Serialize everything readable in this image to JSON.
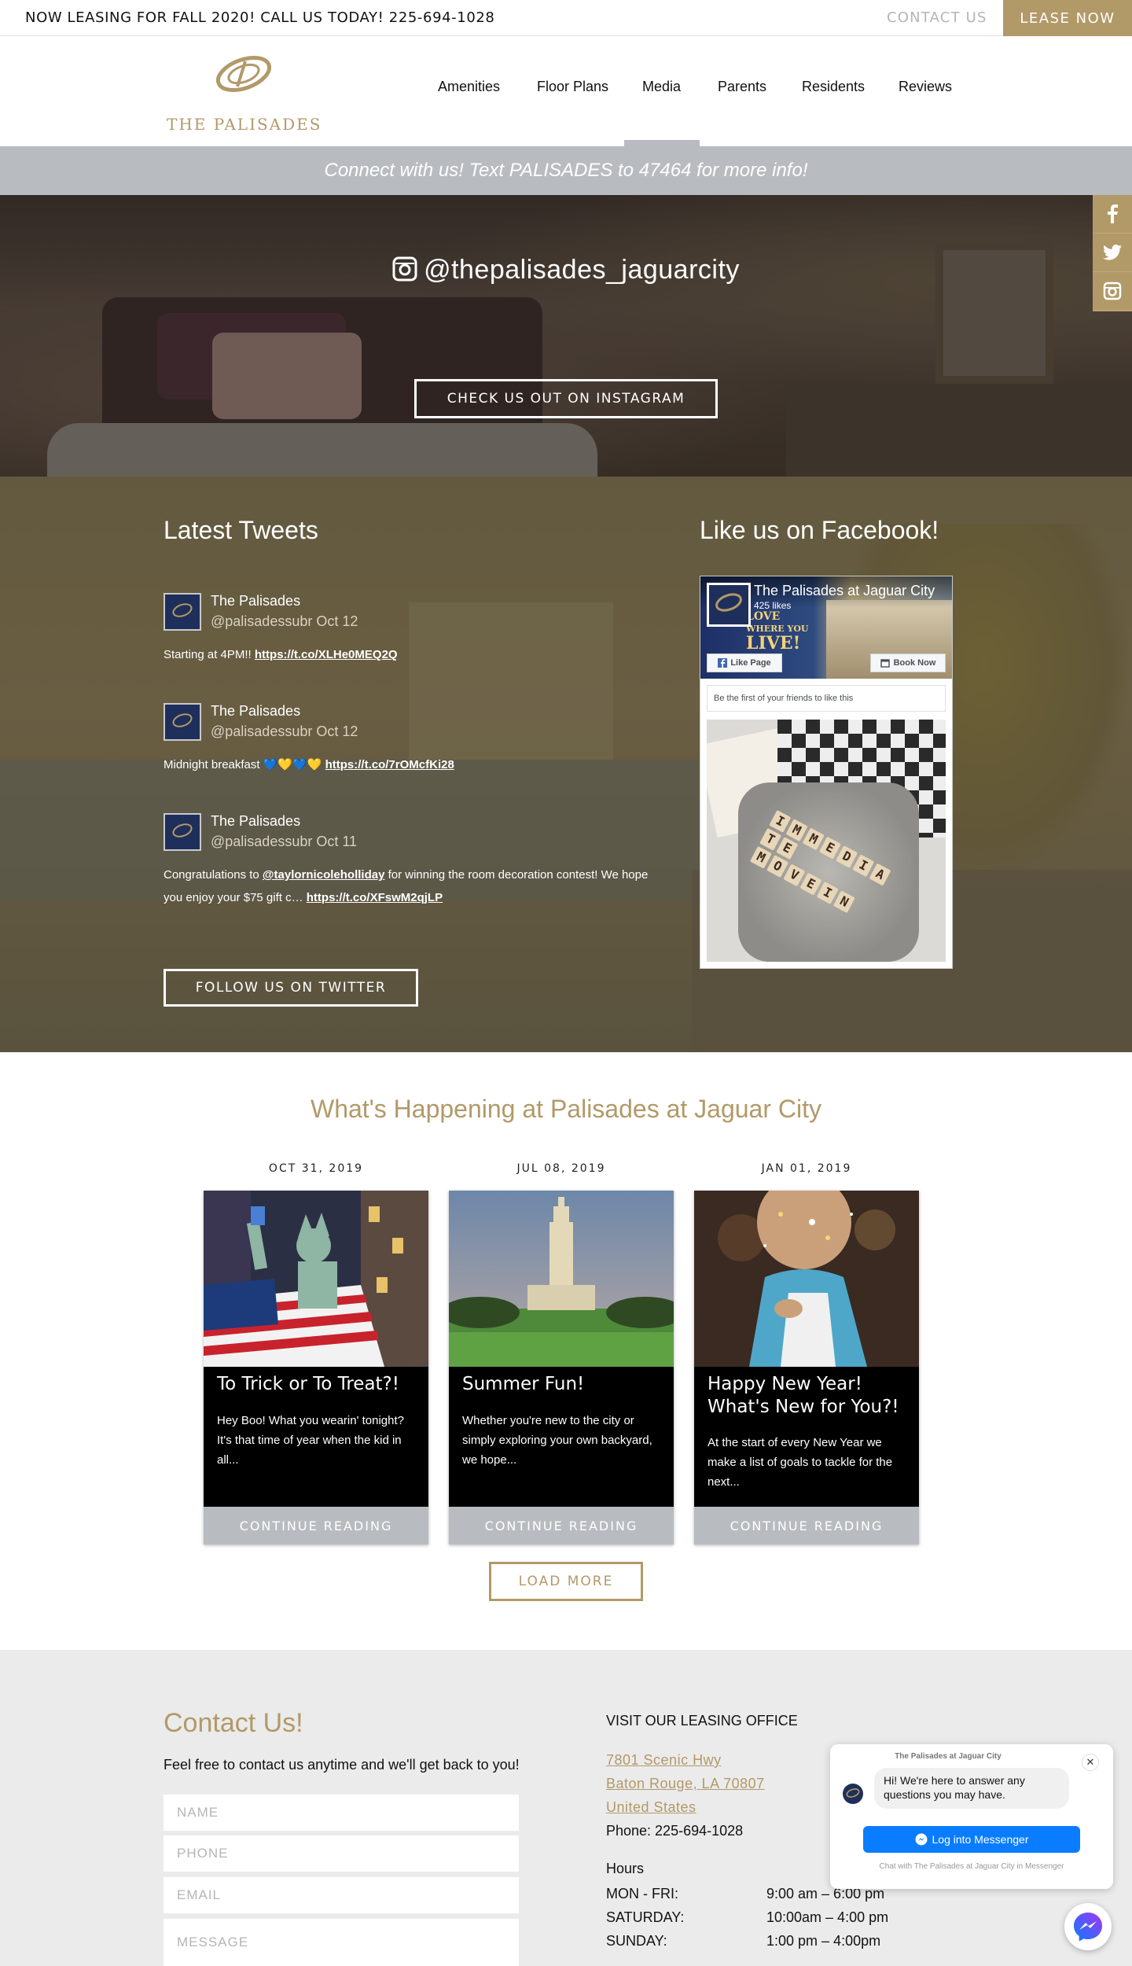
{
  "topbar": {
    "promo": "NOW LEASING FOR FALL 2020! CALL US TODAY! 225-694-1028",
    "contact": "CONTACT US",
    "lease": "LEASE NOW"
  },
  "header": {
    "logo_text": "THE PALISADES",
    "nav": [
      "Amenities",
      "Floor Plans",
      "Media",
      "Parents",
      "Residents",
      "Reviews"
    ],
    "active_nav": "Media"
  },
  "text_banner": "Connect with us! Text PALISADES to 47464 for more info!",
  "instagram": {
    "handle": "@thepalisades_jaguarcity",
    "button": "CHECK US OUT ON INSTAGRAM"
  },
  "social_icons": [
    "facebook-icon",
    "twitter-icon",
    "instagram-icon"
  ],
  "tweets_section": {
    "title": "Latest Tweets",
    "button": "FOLLOW US ON TWITTER",
    "tweets": [
      {
        "name": "The Palisades",
        "meta": "@palisadessubr Oct 12",
        "text": "Starting at 4PM!! ",
        "link": "https://t.co/XLHe0MEQ2Q"
      },
      {
        "name": "The Palisades",
        "meta": "@palisadessubr Oct 12",
        "text": "Midnight breakfast 💙💛💙💛 ",
        "link": "https://t.co/7rOMcfKi28"
      },
      {
        "name": "The Palisades",
        "meta": "@palisadessubr Oct 11",
        "text_a": "Congratulations to ",
        "mention": "@taylornicoleholliday",
        "text_b": " for winning the room decoration contest! We hope you enjoy your $75 gift c… ",
        "link": "https://t.co/XFswM2qjLP"
      }
    ]
  },
  "facebook": {
    "title": "Like us on Facebook!",
    "page_name": "The Palisades at Jaguar City",
    "likes": "425 likes",
    "cover_line1": "LOVE",
    "cover_line2a": "WHERE YOU",
    "cover_line2b": "LIVE!",
    "like_button": "Like Page",
    "book_button": "Book Now",
    "friends_text": "Be the first of your friends to like this",
    "post_tiles": [
      "I",
      "M",
      "M",
      "E",
      "D",
      "I",
      "A",
      "T",
      "E",
      "M",
      "O",
      "V",
      "E",
      "I",
      "N"
    ]
  },
  "events": {
    "title": "What's Happening at Palisades at Jaguar City",
    "load_more": "LOAD MORE",
    "cards": [
      {
        "date": "OCT 31, 2019",
        "title": "To Trick or To Treat?!",
        "excerpt": "Hey Boo! What you wearin' tonight? It's that time of year when the kid in all...",
        "button": "CONTINUE READING"
      },
      {
        "date": "JUL 08, 2019",
        "title": "Summer Fun!",
        "excerpt": "Whether you're new to the city or simply exploring your own backyard, we hope...",
        "button": "CONTINUE READING"
      },
      {
        "date": "JAN 01, 2019",
        "title": "Happy New Year! What's New for You?!",
        "excerpt": "At the start of every New Year we make a list of goals to tackle for the next...",
        "button": "CONTINUE READING"
      }
    ]
  },
  "contact": {
    "title": "Contact Us!",
    "subtitle": "Feel free to contact us anytime and we'll get back to you!",
    "fields": {
      "name": "NAME",
      "phone": "PHONE",
      "email": "EMAIL",
      "message": "MESSAGE"
    }
  },
  "office": {
    "heading": "VISIT OUR LEASING OFFICE",
    "address1": "7801 Scenic Hwy",
    "address2": "Baton Rouge, LA 70807",
    "address3": "United States",
    "phone": "Phone: 225-694-1028",
    "hours_heading": "Hours",
    "hours": [
      {
        "day": "MON - FRI:",
        "time": "9:00 am – 6:00 pm"
      },
      {
        "day": "SATURDAY:",
        "time": "10:00am – 4:00 pm"
      },
      {
        "day": "SUNDAY:",
        "time": "1:00 pm – 4:00pm"
      }
    ]
  },
  "messenger": {
    "title": "The Palisades at Jaguar City",
    "greeting": "Hi! We're here to answer any questions you may have.",
    "button": "Log into Messenger",
    "footer": "Chat with The Palisades at Jaguar City in Messenger",
    "close": "✕"
  },
  "colors": {
    "accent": "#b29968",
    "gray_bar": "#b8bcc1",
    "messenger_blue": "#0a7cff"
  }
}
